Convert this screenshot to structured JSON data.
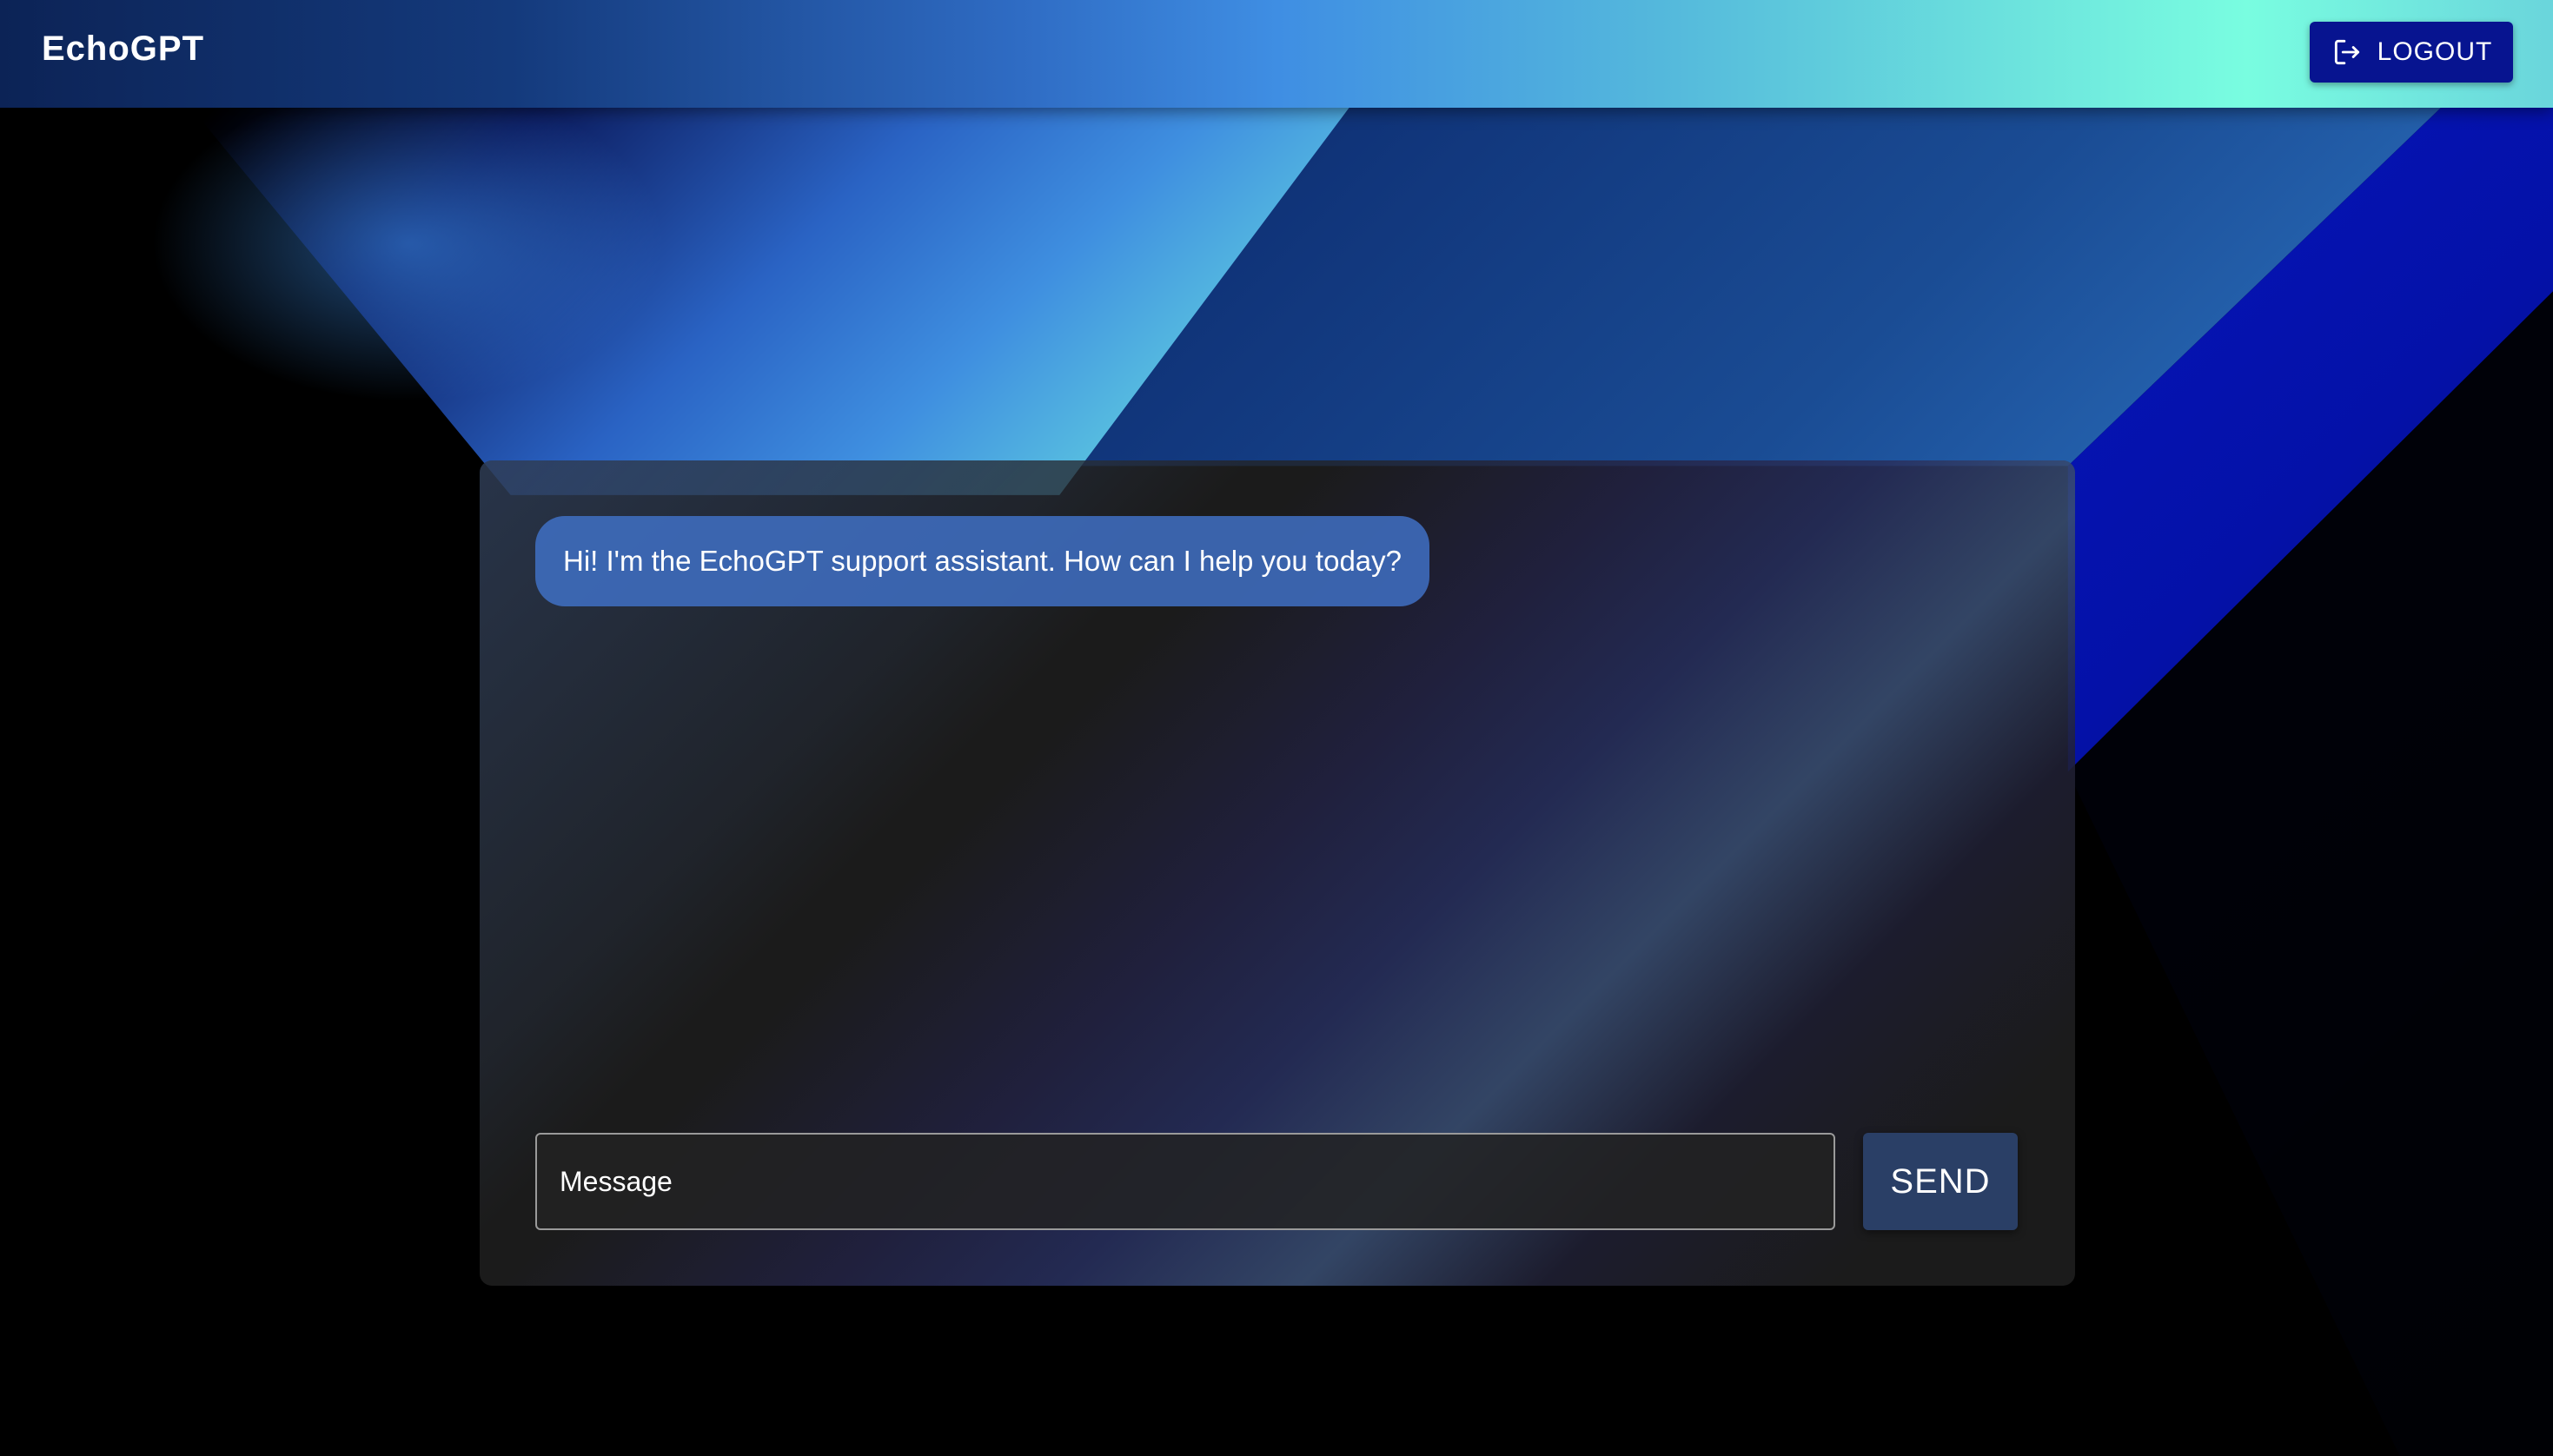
{
  "app": {
    "brand": "EchoGPT"
  },
  "header": {
    "logout_label": "LOGOUT",
    "logout_icon": "logout-icon"
  },
  "chat": {
    "messages": [
      {
        "role": "assistant",
        "text": "Hi! I'm the EchoGPT support assistant. How can I help you today?"
      }
    ],
    "input": {
      "value": "",
      "placeholder": "Message"
    },
    "send_label": "SEND"
  },
  "colors": {
    "topbar_start": "#0c2356",
    "topbar_end": "#79fde0",
    "logout_bg": "#071490",
    "bubble_bg": "#4070c4",
    "send_bg": "#2a3f66",
    "panel_bg": "#222222"
  }
}
